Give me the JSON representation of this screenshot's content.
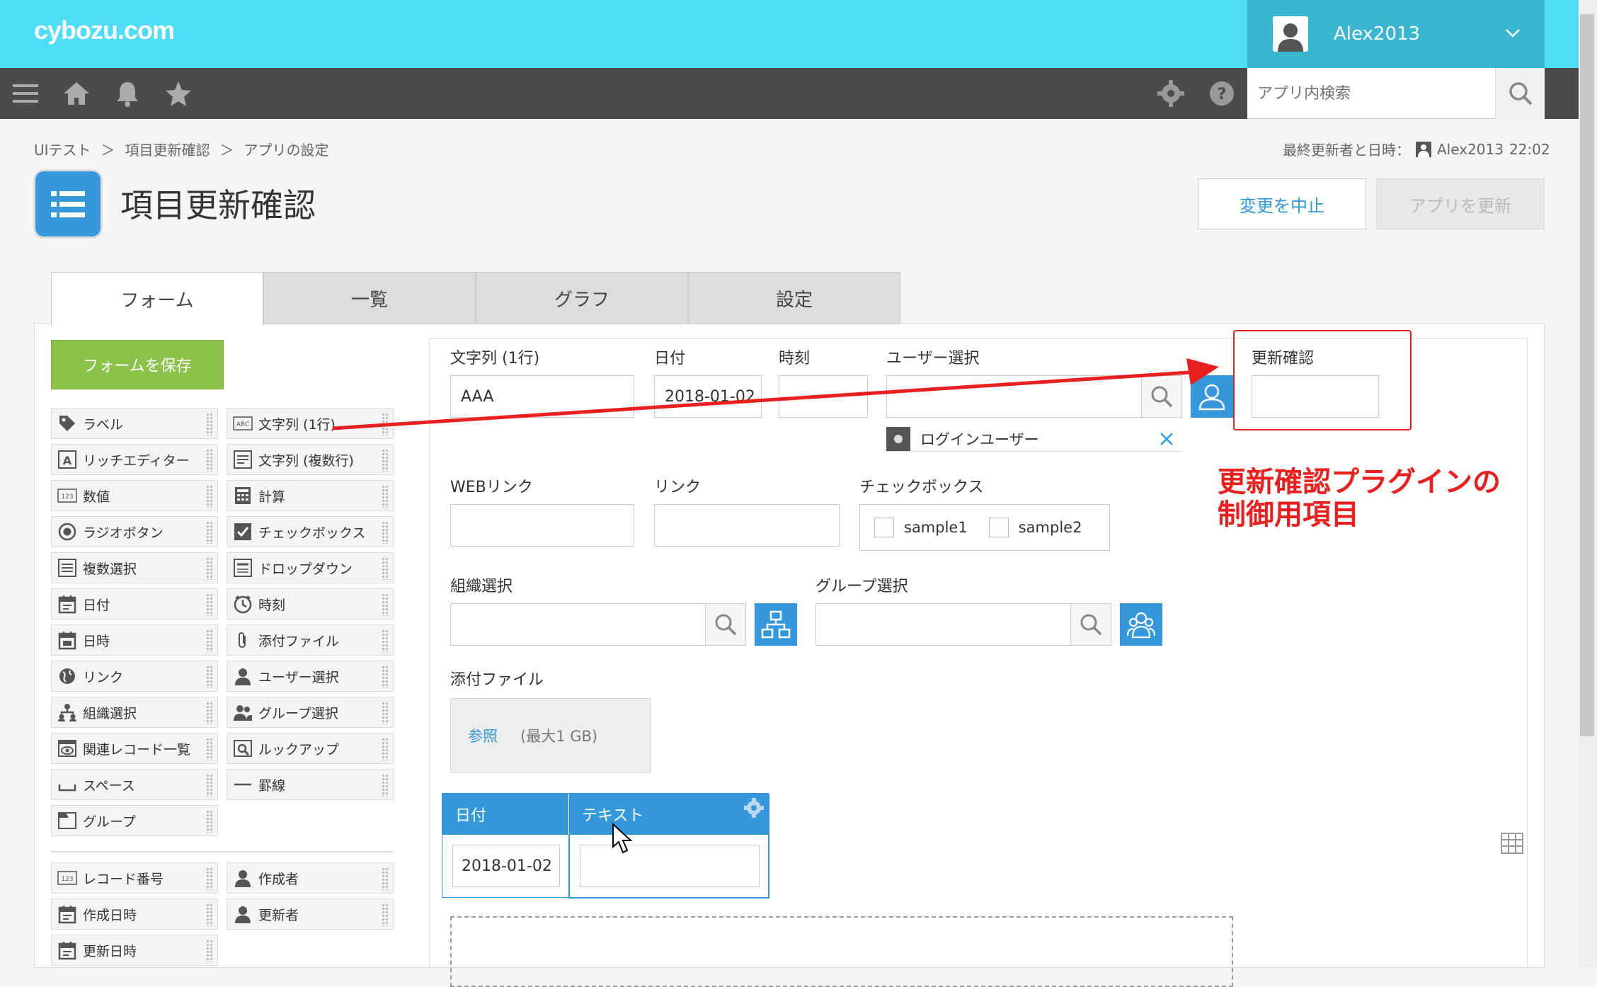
{
  "header": {
    "logo": "cybozu.com",
    "user_name": "Alex2013",
    "search_placeholder": "アプリ内検索"
  },
  "breadcrumb": [
    "UIテスト",
    "＞",
    "項目更新確認",
    "＞",
    "アプリの設定"
  ],
  "last_updated": {
    "label": "最終更新者と日時：",
    "user": "Alex2013",
    "time": "22:02"
  },
  "app": {
    "title": "項目更新確認",
    "cancel_label": "変更を中止",
    "update_label": "アプリを更新"
  },
  "tabs": [
    {
      "label": "フォーム",
      "active": true
    },
    {
      "label": "一覧",
      "active": false
    },
    {
      "label": "グラフ",
      "active": false
    },
    {
      "label": "設定",
      "active": false
    }
  ],
  "palette": {
    "save_label": "フォームを保存",
    "items": [
      {
        "label": "ラベル",
        "icon": "tag-icon"
      },
      {
        "label": "文字列 (1行)",
        "icon": "abc-icon"
      },
      {
        "label": "リッチエディター",
        "icon": "rich-editor-icon"
      },
      {
        "label": "文字列 (複数行)",
        "icon": "multiline-icon"
      },
      {
        "label": "数値",
        "icon": "number-icon"
      },
      {
        "label": "計算",
        "icon": "calculator-icon"
      },
      {
        "label": "ラジオボタン",
        "icon": "radio-icon"
      },
      {
        "label": "チェックボックス",
        "icon": "checkbox-icon"
      },
      {
        "label": "複数選択",
        "icon": "multi-select-icon"
      },
      {
        "label": "ドロップダウン",
        "icon": "dropdown-icon"
      },
      {
        "label": "日付",
        "icon": "calendar-icon"
      },
      {
        "label": "時刻",
        "icon": "clock-icon"
      },
      {
        "label": "日時",
        "icon": "datetime-icon"
      },
      {
        "label": "添付ファイル",
        "icon": "paperclip-icon"
      },
      {
        "label": "リンク",
        "icon": "globe-icon"
      },
      {
        "label": "ユーザー選択",
        "icon": "user-icon"
      },
      {
        "label": "組織選択",
        "icon": "org-icon"
      },
      {
        "label": "グループ選択",
        "icon": "group-icon"
      },
      {
        "label": "関連レコード一覧",
        "icon": "related-records-icon"
      },
      {
        "label": "ルックアップ",
        "icon": "lookup-icon"
      },
      {
        "label": "スペース",
        "icon": "space-icon"
      },
      {
        "label": "罫線",
        "icon": "line-icon"
      },
      {
        "label": "グループ",
        "icon": "group-folder-icon"
      }
    ],
    "system_items": [
      {
        "label": "レコード番号",
        "icon": "number-icon"
      },
      {
        "label": "作成者",
        "icon": "user-icon"
      },
      {
        "label": "作成日時",
        "icon": "calendar-icon"
      },
      {
        "label": "更新者",
        "icon": "user-icon"
      },
      {
        "label": "更新日時",
        "icon": "calendar-icon"
      }
    ]
  },
  "form": {
    "text_label": "文字列 (1行)",
    "text_value": "AAA",
    "date_label": "日付",
    "date_value": "2018-01-02",
    "time_label": "時刻",
    "user_select_label": "ユーザー選択",
    "login_user": "ログインユーザー",
    "confirm_label": "更新確認",
    "web_link_label": "WEBリンク",
    "link_label": "リンク",
    "checkbox_label": "チェックボックス",
    "checkbox_options": [
      "sample1",
      "sample2"
    ],
    "org_label": "組織選択",
    "group_label": "グループ選択",
    "attach_label": "添付ファイル",
    "attach_browse": "参照",
    "attach_limit": "(最大1 GB)",
    "table": {
      "col1": "日付",
      "col2": "テキスト",
      "row_date": "2018-01-02"
    }
  },
  "annotation": {
    "line1": "更新確認プラグインの",
    "line2": "制御用項目",
    "color": "#e82020"
  }
}
